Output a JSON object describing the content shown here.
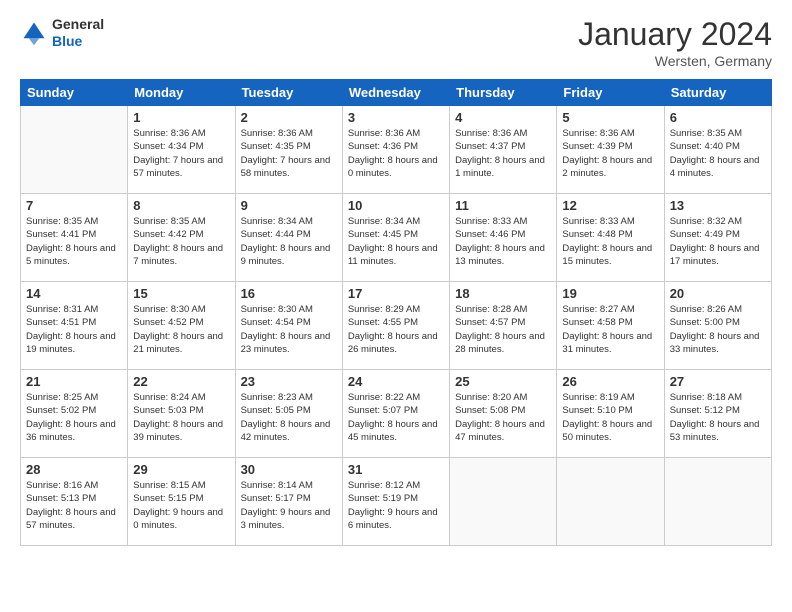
{
  "header": {
    "logo_general": "General",
    "logo_blue": "Blue",
    "month_title": "January 2024",
    "location": "Wersten, Germany"
  },
  "days_of_week": [
    "Sunday",
    "Monday",
    "Tuesday",
    "Wednesday",
    "Thursday",
    "Friday",
    "Saturday"
  ],
  "weeks": [
    [
      {
        "day": "",
        "empty": true
      },
      {
        "day": "1",
        "sunrise": "Sunrise: 8:36 AM",
        "sunset": "Sunset: 4:34 PM",
        "daylight": "Daylight: 7 hours and 57 minutes."
      },
      {
        "day": "2",
        "sunrise": "Sunrise: 8:36 AM",
        "sunset": "Sunset: 4:35 PM",
        "daylight": "Daylight: 7 hours and 58 minutes."
      },
      {
        "day": "3",
        "sunrise": "Sunrise: 8:36 AM",
        "sunset": "Sunset: 4:36 PM",
        "daylight": "Daylight: 8 hours and 0 minutes."
      },
      {
        "day": "4",
        "sunrise": "Sunrise: 8:36 AM",
        "sunset": "Sunset: 4:37 PM",
        "daylight": "Daylight: 8 hours and 1 minute."
      },
      {
        "day": "5",
        "sunrise": "Sunrise: 8:36 AM",
        "sunset": "Sunset: 4:39 PM",
        "daylight": "Daylight: 8 hours and 2 minutes."
      },
      {
        "day": "6",
        "sunrise": "Sunrise: 8:35 AM",
        "sunset": "Sunset: 4:40 PM",
        "daylight": "Daylight: 8 hours and 4 minutes."
      }
    ],
    [
      {
        "day": "7",
        "sunrise": "Sunrise: 8:35 AM",
        "sunset": "Sunset: 4:41 PM",
        "daylight": "Daylight: 8 hours and 5 minutes."
      },
      {
        "day": "8",
        "sunrise": "Sunrise: 8:35 AM",
        "sunset": "Sunset: 4:42 PM",
        "daylight": "Daylight: 8 hours and 7 minutes."
      },
      {
        "day": "9",
        "sunrise": "Sunrise: 8:34 AM",
        "sunset": "Sunset: 4:44 PM",
        "daylight": "Daylight: 8 hours and 9 minutes."
      },
      {
        "day": "10",
        "sunrise": "Sunrise: 8:34 AM",
        "sunset": "Sunset: 4:45 PM",
        "daylight": "Daylight: 8 hours and 11 minutes."
      },
      {
        "day": "11",
        "sunrise": "Sunrise: 8:33 AM",
        "sunset": "Sunset: 4:46 PM",
        "daylight": "Daylight: 8 hours and 13 minutes."
      },
      {
        "day": "12",
        "sunrise": "Sunrise: 8:33 AM",
        "sunset": "Sunset: 4:48 PM",
        "daylight": "Daylight: 8 hours and 15 minutes."
      },
      {
        "day": "13",
        "sunrise": "Sunrise: 8:32 AM",
        "sunset": "Sunset: 4:49 PM",
        "daylight": "Daylight: 8 hours and 17 minutes."
      }
    ],
    [
      {
        "day": "14",
        "sunrise": "Sunrise: 8:31 AM",
        "sunset": "Sunset: 4:51 PM",
        "daylight": "Daylight: 8 hours and 19 minutes."
      },
      {
        "day": "15",
        "sunrise": "Sunrise: 8:30 AM",
        "sunset": "Sunset: 4:52 PM",
        "daylight": "Daylight: 8 hours and 21 minutes."
      },
      {
        "day": "16",
        "sunrise": "Sunrise: 8:30 AM",
        "sunset": "Sunset: 4:54 PM",
        "daylight": "Daylight: 8 hours and 23 minutes."
      },
      {
        "day": "17",
        "sunrise": "Sunrise: 8:29 AM",
        "sunset": "Sunset: 4:55 PM",
        "daylight": "Daylight: 8 hours and 26 minutes."
      },
      {
        "day": "18",
        "sunrise": "Sunrise: 8:28 AM",
        "sunset": "Sunset: 4:57 PM",
        "daylight": "Daylight: 8 hours and 28 minutes."
      },
      {
        "day": "19",
        "sunrise": "Sunrise: 8:27 AM",
        "sunset": "Sunset: 4:58 PM",
        "daylight": "Daylight: 8 hours and 31 minutes."
      },
      {
        "day": "20",
        "sunrise": "Sunrise: 8:26 AM",
        "sunset": "Sunset: 5:00 PM",
        "daylight": "Daylight: 8 hours and 33 minutes."
      }
    ],
    [
      {
        "day": "21",
        "sunrise": "Sunrise: 8:25 AM",
        "sunset": "Sunset: 5:02 PM",
        "daylight": "Daylight: 8 hours and 36 minutes."
      },
      {
        "day": "22",
        "sunrise": "Sunrise: 8:24 AM",
        "sunset": "Sunset: 5:03 PM",
        "daylight": "Daylight: 8 hours and 39 minutes."
      },
      {
        "day": "23",
        "sunrise": "Sunrise: 8:23 AM",
        "sunset": "Sunset: 5:05 PM",
        "daylight": "Daylight: 8 hours and 42 minutes."
      },
      {
        "day": "24",
        "sunrise": "Sunrise: 8:22 AM",
        "sunset": "Sunset: 5:07 PM",
        "daylight": "Daylight: 8 hours and 45 minutes."
      },
      {
        "day": "25",
        "sunrise": "Sunrise: 8:20 AM",
        "sunset": "Sunset: 5:08 PM",
        "daylight": "Daylight: 8 hours and 47 minutes."
      },
      {
        "day": "26",
        "sunrise": "Sunrise: 8:19 AM",
        "sunset": "Sunset: 5:10 PM",
        "daylight": "Daylight: 8 hours and 50 minutes."
      },
      {
        "day": "27",
        "sunrise": "Sunrise: 8:18 AM",
        "sunset": "Sunset: 5:12 PM",
        "daylight": "Daylight: 8 hours and 53 minutes."
      }
    ],
    [
      {
        "day": "28",
        "sunrise": "Sunrise: 8:16 AM",
        "sunset": "Sunset: 5:13 PM",
        "daylight": "Daylight: 8 hours and 57 minutes."
      },
      {
        "day": "29",
        "sunrise": "Sunrise: 8:15 AM",
        "sunset": "Sunset: 5:15 PM",
        "daylight": "Daylight: 9 hours and 0 minutes."
      },
      {
        "day": "30",
        "sunrise": "Sunrise: 8:14 AM",
        "sunset": "Sunset: 5:17 PM",
        "daylight": "Daylight: 9 hours and 3 minutes."
      },
      {
        "day": "31",
        "sunrise": "Sunrise: 8:12 AM",
        "sunset": "Sunset: 5:19 PM",
        "daylight": "Daylight: 9 hours and 6 minutes."
      },
      {
        "day": "",
        "empty": true
      },
      {
        "day": "",
        "empty": true
      },
      {
        "day": "",
        "empty": true
      }
    ]
  ]
}
